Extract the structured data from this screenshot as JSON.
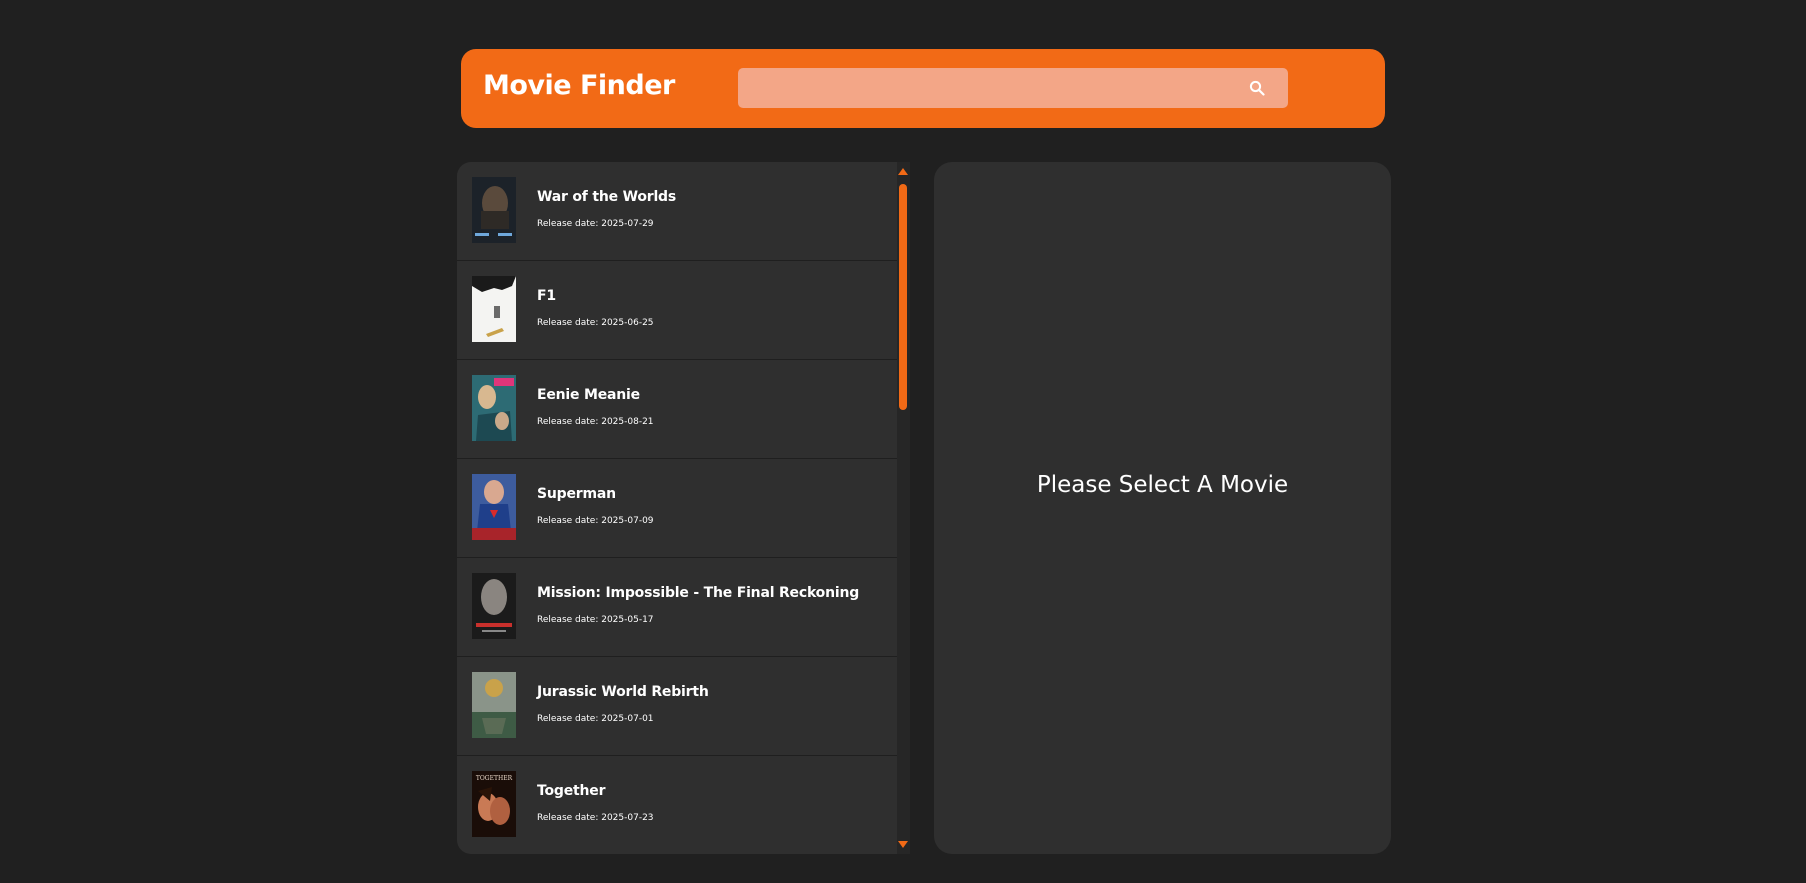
{
  "header": {
    "title": "Movie Finder",
    "search_value": "",
    "search_icon": "search-icon",
    "accent_color": "#f26a16"
  },
  "movies": [
    {
      "title": "War of the Worlds",
      "date": "Release date: 2025-07-29"
    },
    {
      "title": "F1",
      "date": "Release date: 2025-06-25"
    },
    {
      "title": "Eenie Meanie",
      "date": "Release date: 2025-08-21"
    },
    {
      "title": "Superman",
      "date": "Release date: 2025-07-09"
    },
    {
      "title": "Mission: Impossible - The Final Reckoning",
      "date": "Release date: 2025-05-17"
    },
    {
      "title": "Jurassic World Rebirth",
      "date": "Release date: 2025-07-01"
    },
    {
      "title": "Together",
      "date": "Release date: 2025-07-23"
    }
  ],
  "poster_text": {
    "together": "TOGETHER"
  },
  "detail": {
    "placeholder": "Please Select A Movie"
  }
}
